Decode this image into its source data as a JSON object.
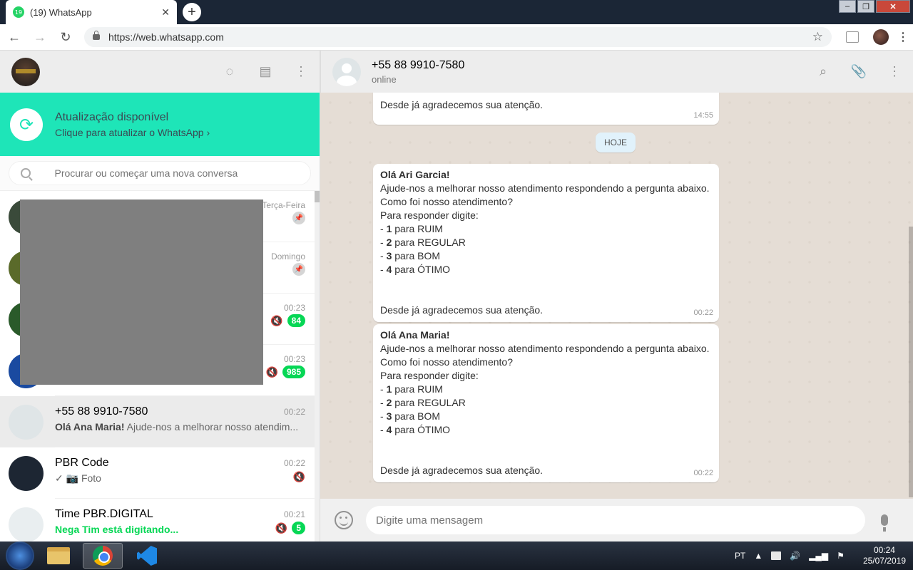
{
  "browser": {
    "tab_title": "(19) WhatsApp",
    "tab_badge": "19",
    "url": "https://web.whatsapp.com"
  },
  "update_banner": {
    "title": "Atualização disponível",
    "subtitle": "Clique para atualizar o WhatsApp ›"
  },
  "search": {
    "placeholder": "Procurar ou começar uma nova conversa"
  },
  "chats": [
    {
      "time": "Terça-Feira",
      "pinned": true
    },
    {
      "time": "Domingo",
      "pinned": true
    },
    {
      "time": "00:23",
      "muted": true,
      "unread": "84"
    },
    {
      "time": "00:23",
      "muted": true,
      "unread": "985"
    },
    {
      "name": "+55 88 9910-7580",
      "time": "00:22",
      "preview_bold": "Olá Ana Maria!",
      "preview": " Ajude-nos a melhorar nosso atendim..."
    },
    {
      "name": "PBR Code",
      "time": "00:22",
      "preview": "✓ 📷 Foto",
      "muted": true
    },
    {
      "name": "Time PBR.DIGITAL",
      "time": "00:21",
      "preview": "Nega Tim está digitando...",
      "muted": true,
      "unread": "5"
    }
  ],
  "conversation": {
    "contact_name": "+55 88 9910-7580",
    "contact_status": "online",
    "day_label": "HOJE",
    "messages": [
      {
        "footer": "Desde já agradecemos sua atenção.",
        "time": "14:55"
      },
      {
        "greeting": "Olá Ari Garcia!",
        "lines": [
          "Ajude-nos a melhorar nosso atendimento respondendo a pergunta abaixo.",
          "Como foi nosso atendimento?",
          "Para responder digite:"
        ],
        "options": [
          [
            "1",
            " para RUIM"
          ],
          [
            "2",
            " para REGULAR"
          ],
          [
            "3",
            " para BOM"
          ],
          [
            "4",
            " para ÓTIMO"
          ]
        ],
        "footer": "Desde já agradecemos sua atenção.",
        "time": "00:22"
      },
      {
        "greeting": "Olá Ana Maria!",
        "lines": [
          "Ajude-nos a melhorar nosso atendimento respondendo a pergunta abaixo.",
          "Como foi nosso atendimento?",
          "Para responder digite:"
        ],
        "options": [
          [
            "1",
            " para RUIM"
          ],
          [
            "2",
            " para REGULAR"
          ],
          [
            "3",
            " para BOM"
          ],
          [
            "4",
            " para ÓTIMO"
          ]
        ],
        "footer": "Desde já agradecemos sua atenção.",
        "time": "00:22"
      }
    ],
    "composer_placeholder": "Digite uma mensagem"
  },
  "taskbar": {
    "language": "PT",
    "time": "00:24",
    "date": "25/07/2019"
  },
  "colors": {
    "accent": "#1ee5b8",
    "unread_badge": "#06d755",
    "chat_bg": "#e5ddd5"
  }
}
